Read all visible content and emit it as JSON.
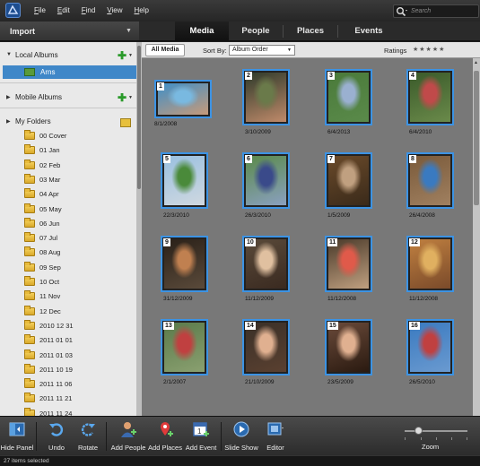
{
  "menu": [
    "File",
    "Edit",
    "Find",
    "View",
    "Help"
  ],
  "search": {
    "placeholder": "Search"
  },
  "import_label": "Import",
  "tabs": [
    "Media",
    "People",
    "Places",
    "Events"
  ],
  "active_tab": "Media",
  "sidebar": {
    "local_albums": "Local Albums",
    "album": "Arns",
    "mobile_albums": "Mobile Albums",
    "my_folders": "My Folders",
    "folders": [
      "00 Cover",
      "01 Jan",
      "02 Feb",
      "03 Mar",
      "04 Apr",
      "05 May",
      "06 Jun",
      "07 Jul",
      "08 Aug",
      "09 Sep",
      "10 Oct",
      "11 Nov",
      "12 Dec",
      "2010 12 31",
      "2011 01 01",
      "2011 01 03",
      "2011 10 19",
      "2011 11 06",
      "2011 11 21",
      "2011 11 24",
      "2011 12 08"
    ]
  },
  "grid_header": {
    "all_media": "All Media",
    "sort_by": "Sort By:",
    "sort_value": "Album Order",
    "ratings": "Ratings",
    "stars": "★★★★★"
  },
  "thumbnails": [
    {
      "n": "1",
      "date": "8/1/2008",
      "orient": "land",
      "colors": [
        "#3f8fc8",
        "#79b9e0",
        "#c69a7a"
      ]
    },
    {
      "n": "2",
      "date": "3/10/2009",
      "orient": "port",
      "colors": [
        "#2e3a2a",
        "#6a7a4a",
        "#c08a6a"
      ]
    },
    {
      "n": "3",
      "date": "6/4/2013",
      "orient": "port",
      "colors": [
        "#4a7a3a",
        "#9ab0d0",
        "#5a8a4a"
      ]
    },
    {
      "n": "4",
      "date": "6/4/2010",
      "orient": "port",
      "colors": [
        "#3a5a2a",
        "#c04a4a",
        "#6a8a4a"
      ]
    },
    {
      "n": "5",
      "date": "22/3/2010",
      "orient": "port",
      "colors": [
        "#9ac0e0",
        "#4a8a3a",
        "#cfd8e0"
      ]
    },
    {
      "n": "6",
      "date": "26/3/2010",
      "orient": "port",
      "colors": [
        "#5a8a4a",
        "#3a4a8a",
        "#8aa0c0"
      ]
    },
    {
      "n": "7",
      "date": "1/5/2009",
      "orient": "port",
      "colors": [
        "#6a4a2a",
        "#c0a080",
        "#3a2a1a"
      ]
    },
    {
      "n": "8",
      "date": "26/4/2008",
      "orient": "port",
      "colors": [
        "#7a5a3a",
        "#3a7ac0",
        "#a08060"
      ]
    },
    {
      "n": "9",
      "date": "31/12/2009",
      "orient": "port",
      "colors": [
        "#2a2018",
        "#c08050",
        "#5a4a3a"
      ]
    },
    {
      "n": "10",
      "date": "11/12/2009",
      "orient": "port",
      "colors": [
        "#5a4a3a",
        "#e0c0a0",
        "#3a2a20"
      ]
    },
    {
      "n": "11",
      "date": "11/12/2008",
      "orient": "port",
      "colors": [
        "#4a3a2a",
        "#e05a4a",
        "#c0a080"
      ]
    },
    {
      "n": "12",
      "date": "11/12/2008",
      "orient": "port",
      "colors": [
        "#c08040",
        "#e0b060",
        "#7a4a2a"
      ]
    },
    {
      "n": "13",
      "date": "2/1/2007",
      "orient": "port",
      "colors": [
        "#5a7a4a",
        "#c04040",
        "#8aa070"
      ]
    },
    {
      "n": "14",
      "date": "21/10/2009",
      "orient": "port",
      "colors": [
        "#3a3028",
        "#e0b090",
        "#5a4030"
      ]
    },
    {
      "n": "15",
      "date": "23/5/2009",
      "orient": "port",
      "colors": [
        "#6a4a3a",
        "#e0b090",
        "#2a1a10"
      ]
    },
    {
      "n": "16",
      "date": "26/5/2010",
      "orient": "port",
      "colors": [
        "#3a7ac0",
        "#c04040",
        "#6a9ad0"
      ]
    }
  ],
  "toolbar": [
    "Hide Panel",
    "Undo",
    "Rotate",
    "Add People",
    "Add Places",
    "Add Event",
    "Slide Show",
    "Editor"
  ],
  "zoom_label": "Zoom",
  "status": "27 items selected"
}
